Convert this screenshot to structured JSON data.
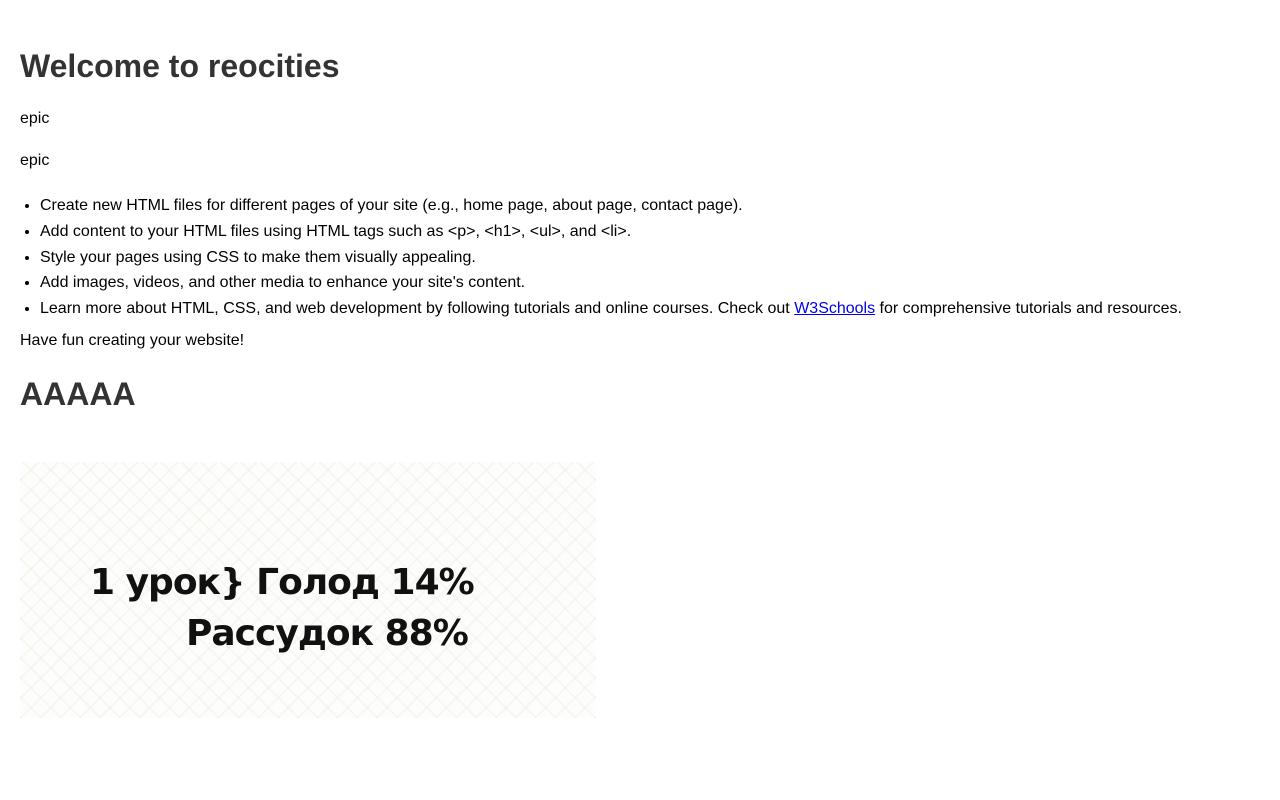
{
  "page": {
    "title": "Welcome to reocities",
    "paragraphs": [
      "epic",
      "epic"
    ],
    "tips": [
      {
        "text": "Create new HTML files for different pages of your site (e.g., home page, about page, contact page)."
      },
      {
        "text": "Add content to your HTML files using HTML tags such as <p>, <h1>, <ul>, and <li>."
      },
      {
        "text": "Style your pages using CSS to make them visually appealing."
      },
      {
        "text": "Add images, videos, and other media to enhance your site's content."
      },
      {
        "before": "Learn more about HTML, CSS, and web development by following tutorials and online courses. Check out ",
        "link_text": "W3Schools",
        "after": " for comprehensive tutorials and resources."
      }
    ],
    "outro": "Have fun creating your website!",
    "subheading": "AAAAA",
    "image": {
      "line1": "1 урок} Голод 14%",
      "line2": "Рассудок 88%"
    }
  }
}
